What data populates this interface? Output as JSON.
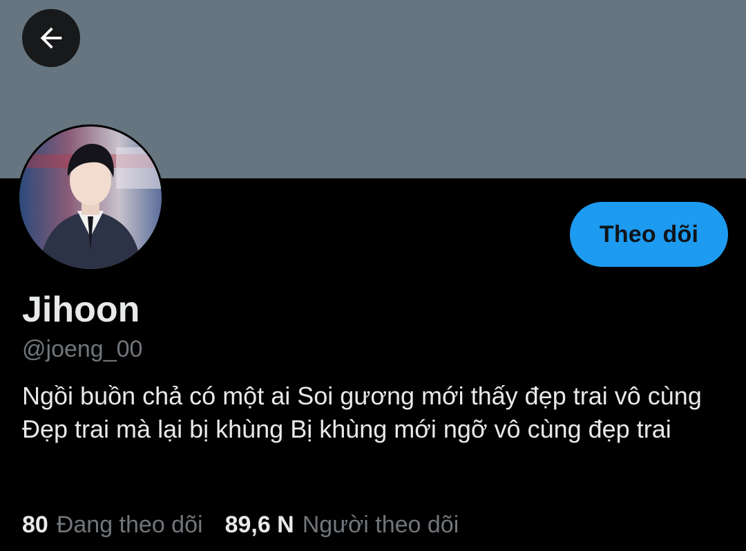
{
  "header": {
    "back_icon": "arrow-left-icon",
    "banner_color": "#66757f"
  },
  "profile": {
    "avatar_alt": "profile photo",
    "follow_label": "Theo dõi",
    "name": "Jihoon",
    "handle": "@joeng_00",
    "bio": "Ngồi buồn chả có một ai Soi gương mới thấy đẹp trai vô cùng Đẹp trai mà lại bị khùng Bị khùng mới ngỡ vô cùng đẹp trai"
  },
  "stats": {
    "following_count": "80",
    "following_label": "Đang theo dõi",
    "followers_count": "89,6 N",
    "followers_label": "Người theo dõi"
  },
  "colors": {
    "accent": "#1d9bf0",
    "background": "#000000",
    "primary_text": "#e7e9ea",
    "secondary_text": "#71767b"
  }
}
